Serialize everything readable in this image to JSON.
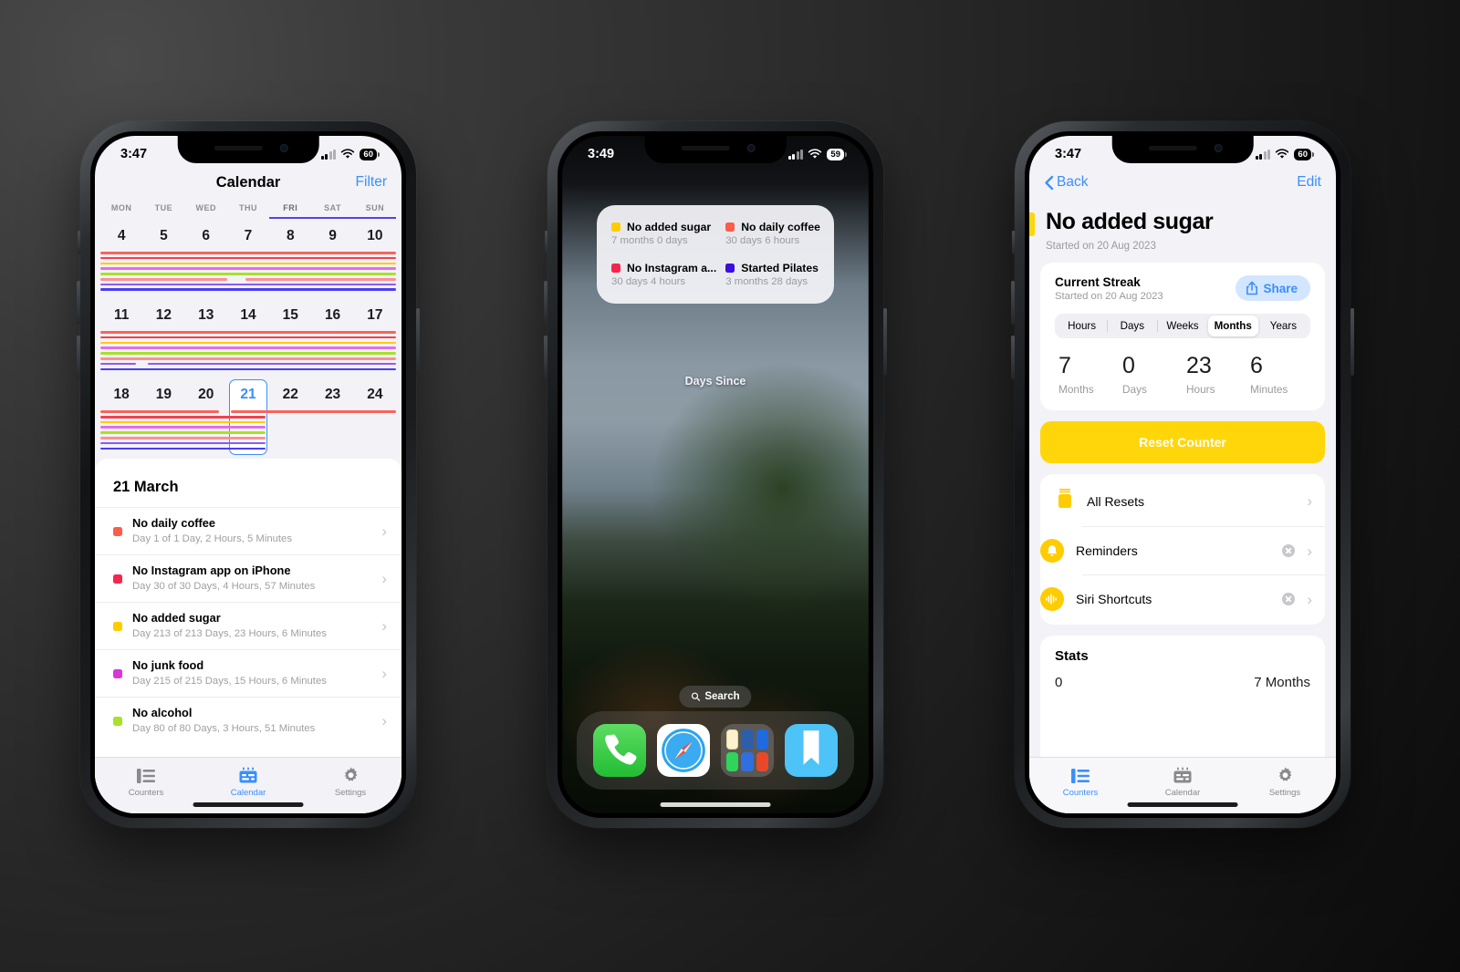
{
  "app": {
    "name": "Days Since"
  },
  "phone1": {
    "status": {
      "time": "3:47",
      "battery": "60"
    },
    "nav": {
      "title": "Calendar",
      "filter_label": "Filter"
    },
    "weekdays": [
      "MON",
      "TUE",
      "WED",
      "THU",
      "FRI",
      "SAT",
      "SUN"
    ],
    "active_weekday_index": 4,
    "weeks": [
      {
        "days": [
          "4",
          "5",
          "6",
          "7",
          "8",
          "9",
          "10"
        ],
        "stripes": [
          {
            "color": "#f8655a",
            "span": 1.0,
            "gap": 0
          },
          {
            "color": "#f3404d",
            "span": 1.0,
            "gap": 0
          },
          {
            "color": "#ffcc00",
            "span": 1.0,
            "gap": 0
          },
          {
            "color": "#e06ee8",
            "span": 1.0,
            "gap": 0
          },
          {
            "color": "#a8e02a",
            "span": 1.0,
            "gap": 0
          },
          {
            "color": "#ff8f93",
            "span": 0.49,
            "gap": 0.06
          },
          {
            "color": "#8a5cf6",
            "span": 1.0,
            "gap": 0
          },
          {
            "color": "#4b3ef0",
            "span": 1.0,
            "gap": 0
          }
        ]
      },
      {
        "days": [
          "11",
          "12",
          "13",
          "14",
          "15",
          "16",
          "17"
        ],
        "stripes": [
          {
            "color": "#f8655a",
            "span": 1.0,
            "gap": 0
          },
          {
            "color": "#f3404d",
            "span": 1.0,
            "gap": 0
          },
          {
            "color": "#ffcc00",
            "span": 1.0,
            "gap": 0
          },
          {
            "color": "#e06ee8",
            "span": 1.0,
            "gap": 0
          },
          {
            "color": "#a8e02a",
            "span": 1.0,
            "gap": 0
          },
          {
            "color": "#ff8f93",
            "span": 1.0,
            "gap": 0
          },
          {
            "color": "#8a5cf6",
            "span": 0.16,
            "gap": 0.04
          },
          {
            "color": "#4b3ef0",
            "span": 1.0,
            "gap": 0
          }
        ]
      },
      {
        "days": [
          "18",
          "19",
          "20",
          "21",
          "22",
          "23",
          "24"
        ],
        "selected_index": 3,
        "stripes": [
          {
            "color": "#f8655a",
            "span": 0.44,
            "gap": 0.04
          },
          {
            "color": "#f3404d",
            "span": 0.56,
            "gap": 0
          },
          {
            "color": "#ffcc00",
            "span": 0.56,
            "gap": 0
          },
          {
            "color": "#e06ee8",
            "span": 0.56,
            "gap": 0
          },
          {
            "color": "#a8e02a",
            "span": 0.56,
            "gap": 0
          },
          {
            "color": "#ff8f93",
            "span": 0.56,
            "gap": 0
          },
          {
            "color": "#8a5cf6",
            "span": 0.56,
            "gap": 0
          },
          {
            "color": "#4b3ef0",
            "span": 0.56,
            "gap": 0
          }
        ]
      }
    ],
    "sheet": {
      "date_heading": "21 March",
      "entries": [
        {
          "color": "#fb5d49",
          "name": "No daily coffee",
          "detail": "Day 1 of 1 Day, 2 Hours, 5 Minutes"
        },
        {
          "color": "#f5264d",
          "name": "No Instagram app on iPhone",
          "detail": "Day 30 of 30 Days, 4 Hours, 57 Minutes"
        },
        {
          "color": "#ffcc00",
          "name": "No added sugar",
          "detail": "Day 213 of 213 Days, 23 Hours, 6 Minutes"
        },
        {
          "color": "#d936d9",
          "name": "No junk food",
          "detail": "Day 215 of 215 Days, 15 Hours, 6 Minutes"
        },
        {
          "color": "#a8e02a",
          "name": "No alcohol",
          "detail": "Day 80 of 80 Days, 3 Hours, 51 Minutes"
        }
      ]
    },
    "tabs": [
      {
        "label": "Counters",
        "icon": "list-icon",
        "active": false
      },
      {
        "label": "Calendar",
        "icon": "calendar-icon",
        "active": true
      },
      {
        "label": "Settings",
        "icon": "gear-icon",
        "active": false
      }
    ]
  },
  "phone2": {
    "status": {
      "time": "3:49",
      "battery": "59"
    },
    "widget": {
      "label": "Days Since",
      "items": [
        {
          "color": "#ffcc00",
          "name": "No added sugar",
          "value": "7 months 0 days"
        },
        {
          "color": "#fb5d49",
          "name": "No daily coffee",
          "value": "30 days 6 hours"
        },
        {
          "color": "#f5264d",
          "name": "No Instagram a...",
          "value": "30 days 4 hours"
        },
        {
          "color": "#3a0fdb",
          "name": "Started Pilates",
          "value": "3 months 28 days"
        }
      ]
    },
    "search": {
      "label": "Search",
      "icon": "search-icon"
    },
    "dock": [
      {
        "name": "phone-app-icon"
      },
      {
        "name": "safari-app-icon"
      },
      {
        "name": "app-folder-icon"
      },
      {
        "name": "days-since-app-icon"
      }
    ]
  },
  "phone3": {
    "status": {
      "time": "3:47",
      "battery": "60"
    },
    "nav": {
      "back_label": "Back",
      "edit_label": "Edit"
    },
    "header": {
      "title": "No added sugar",
      "started": "Started on 20 Aug 2023",
      "accent": "#ffd60a"
    },
    "streak": {
      "title": "Current Streak",
      "subtitle": "Started on 20 Aug 2023",
      "share_label": "Share",
      "segments": [
        "Hours",
        "Days",
        "Weeks",
        "Months",
        "Years"
      ],
      "selected_segment": "Months",
      "values": [
        {
          "number": "7",
          "unit": "Months"
        },
        {
          "number": "0",
          "unit": "Days"
        },
        {
          "number": "23",
          "unit": "Hours"
        },
        {
          "number": "6",
          "unit": "Minutes"
        }
      ]
    },
    "reset_label": "Reset Counter",
    "options": [
      {
        "label": "All Resets",
        "icon": "jar-icon",
        "has_clear": false
      },
      {
        "label": "Reminders",
        "icon": "bell-icon",
        "has_clear": true
      },
      {
        "label": "Siri Shortcuts",
        "icon": "siri-icon",
        "has_clear": true
      }
    ],
    "stats": {
      "title": "Stats",
      "left": "0",
      "right": "7 Months"
    },
    "tabs": [
      {
        "label": "Counters",
        "icon": "list-icon",
        "active": true
      },
      {
        "label": "Calendar",
        "icon": "calendar-icon",
        "active": false
      },
      {
        "label": "Settings",
        "icon": "gear-icon",
        "active": false
      }
    ]
  }
}
